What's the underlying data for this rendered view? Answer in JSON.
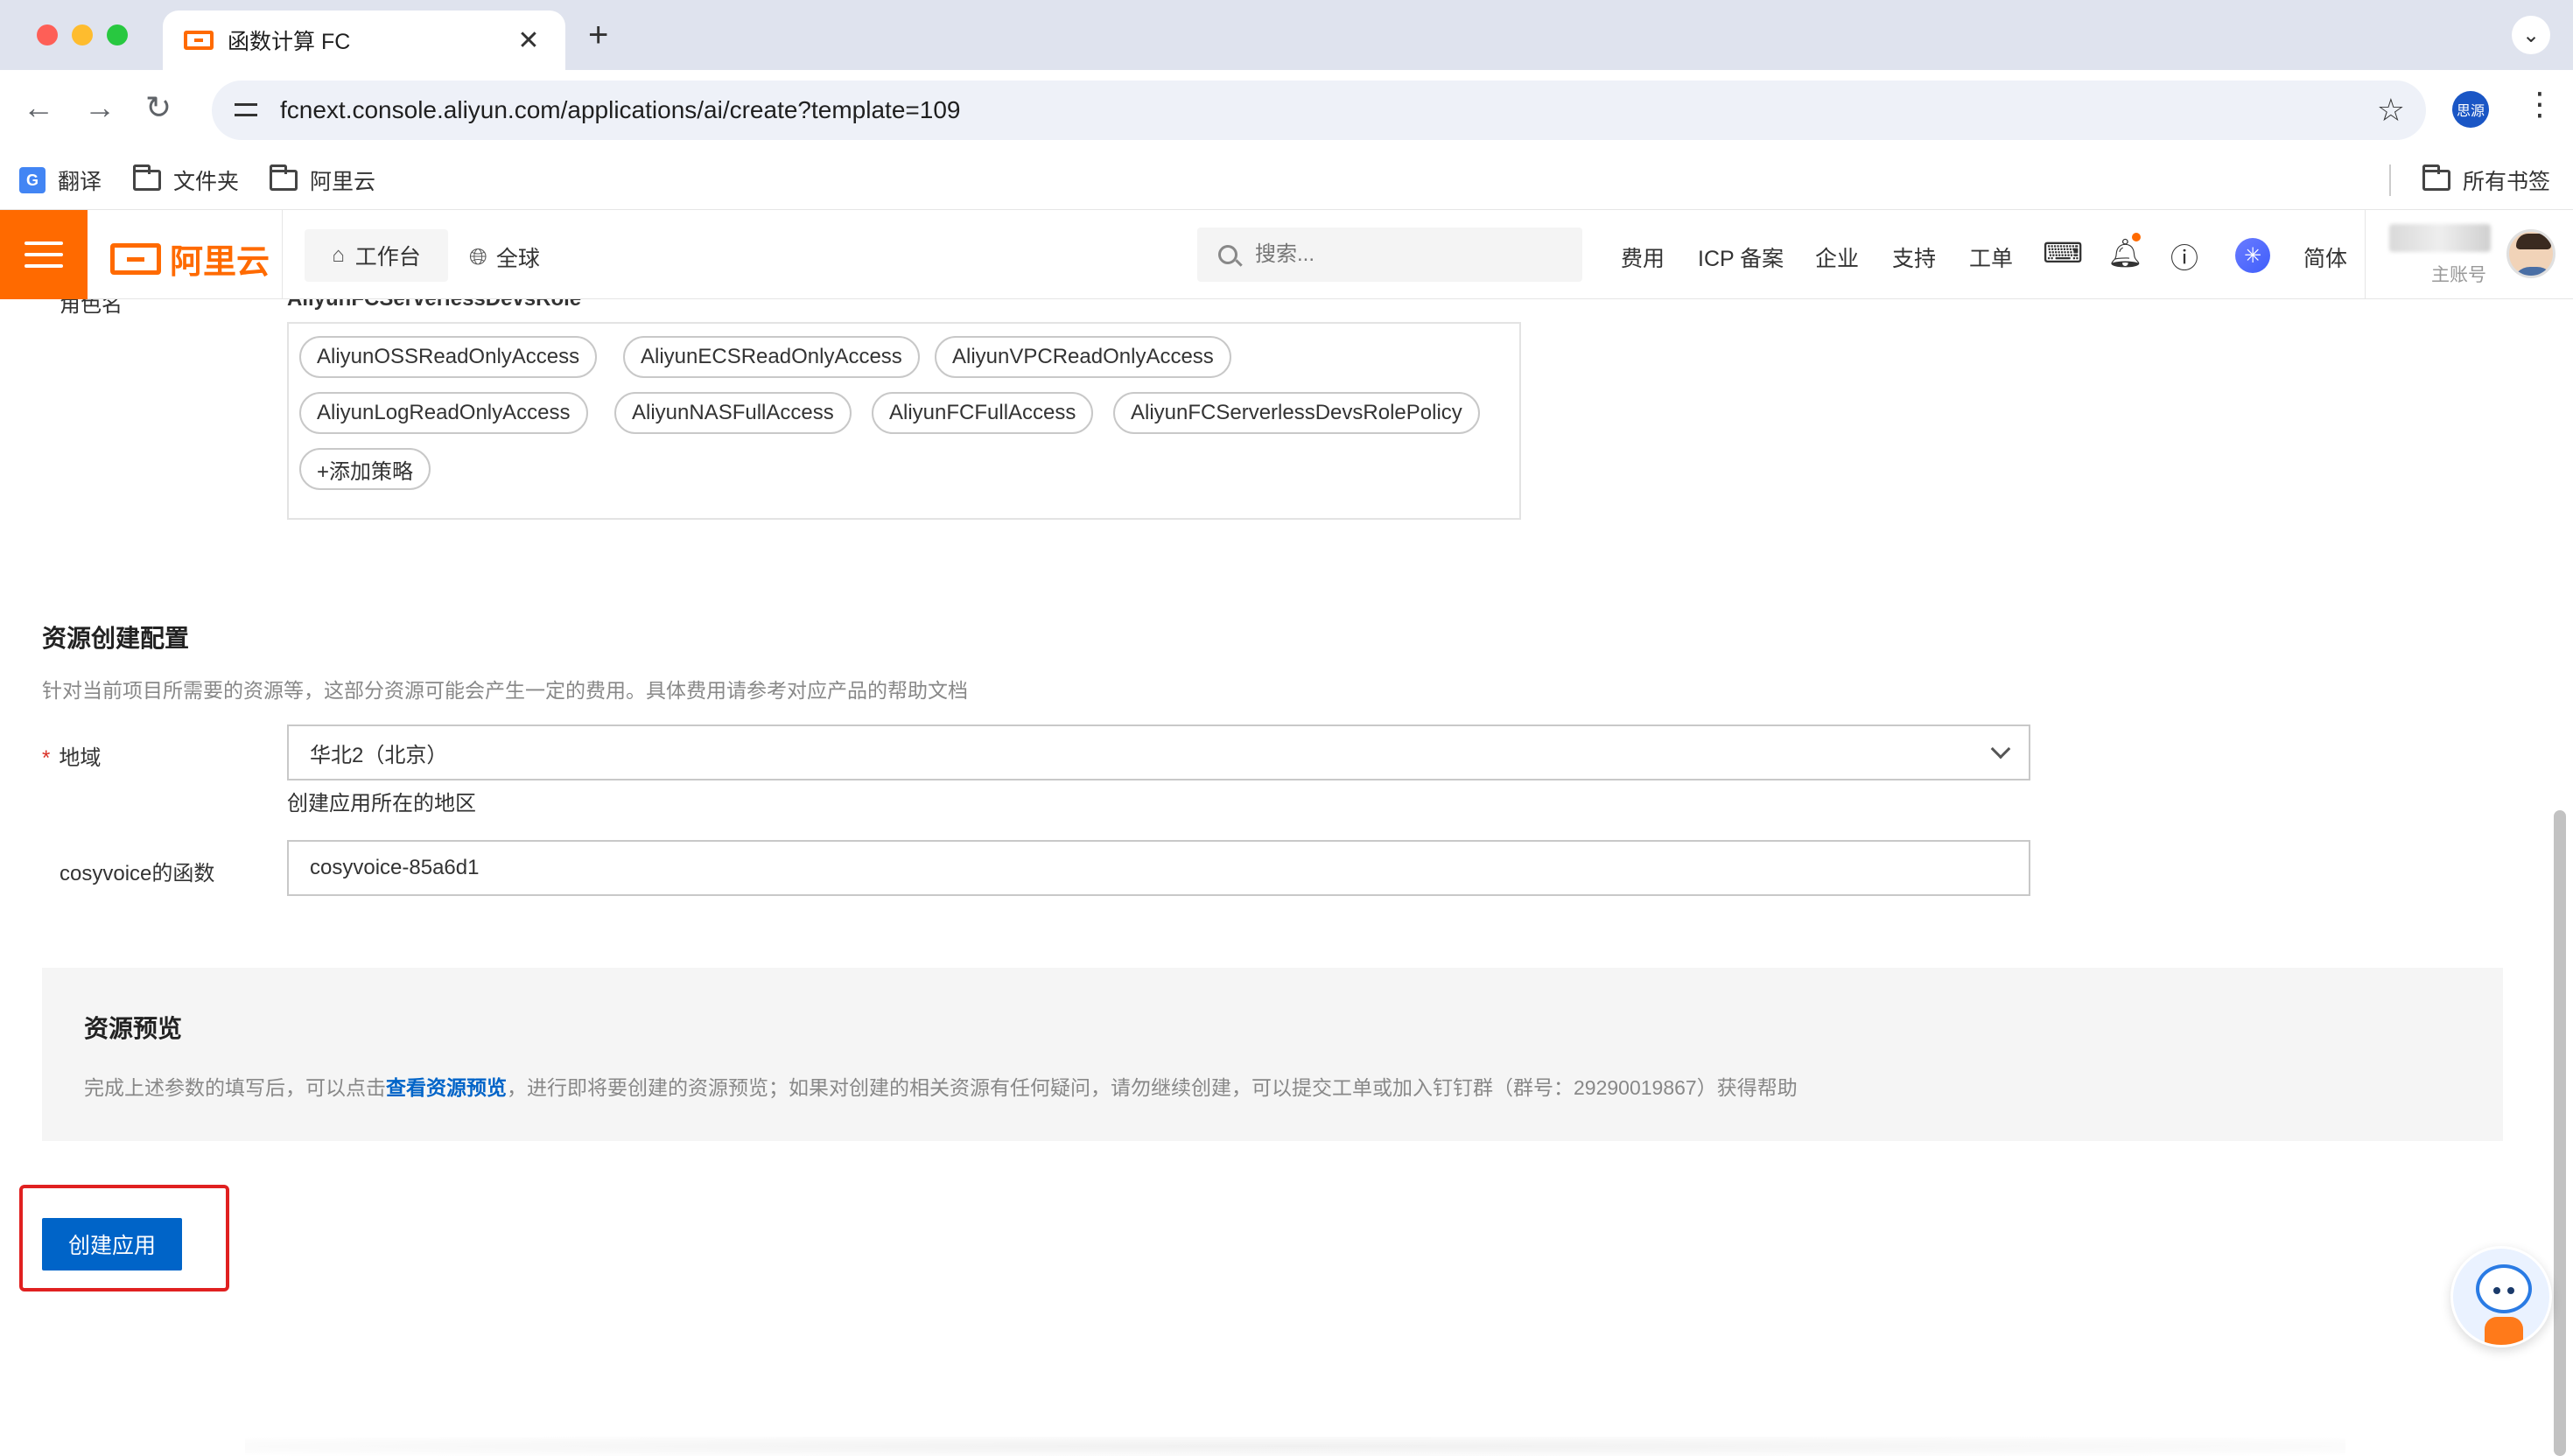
{
  "browser": {
    "tab_title": "函数计算 FC",
    "tab_close": "✕",
    "new_tab": "+",
    "tab_menu": "⌄",
    "url": "fcnext.console.aliyun.com/applications/ai/create?template=109",
    "profile_text": "思源",
    "bookmarks": [
      {
        "label": "翻译",
        "icon": "google-translate-icon"
      },
      {
        "label": "文件夹",
        "icon": "folder-icon"
      },
      {
        "label": "阿里云",
        "icon": "folder-icon"
      }
    ],
    "all_bookmarks": "所有书签"
  },
  "header": {
    "logo_text": "阿里云",
    "workbench": "工作台",
    "global": "全球",
    "search_placeholder": "搜索...",
    "links": [
      "费用",
      "ICP 备案",
      "企业",
      "支持",
      "工单"
    ],
    "lang": "简体",
    "account_label": "主账号",
    "brand_color": "#ff6a00"
  },
  "role": {
    "label": "角色名",
    "value": "AliyunFCServerlessDevsRole",
    "policies": [
      "AliyunOSSReadOnlyAccess",
      "AliyunECSReadOnlyAccess",
      "AliyunVPCReadOnlyAccess",
      "AliyunLogReadOnlyAccess",
      "AliyunNASFullAccess",
      "AliyunFCFullAccess",
      "AliyunFCServerlessDevsRolePolicy"
    ],
    "add_policy": "+添加策略"
  },
  "resource_config": {
    "title": "资源创建配置",
    "description": "针对当前项目所需要的资源等，这部分资源可能会产生一定的费用。具体费用请参考对应产品的帮助文档",
    "region_label": "地域",
    "region_required": "*",
    "region_value": "华北2（北京）",
    "region_help": "创建应用所在的地区",
    "function_label": "cosyvoice的函数",
    "function_value": "cosyvoice-85a6d1"
  },
  "preview": {
    "title": "资源预览",
    "desc_before": "完成上述参数的填写后，可以点击",
    "desc_link": "查看资源预览",
    "desc_after": "，进行即将要创建的资源预览；如果对创建的相关资源有任何疑问，请勿继续创建，可以提交工单或加入钉钉群（群号：29290019867）获得帮助"
  },
  "actions": {
    "create_button": "创建应用",
    "primary_color": "#0064c8",
    "highlight_color": "#e02020"
  }
}
